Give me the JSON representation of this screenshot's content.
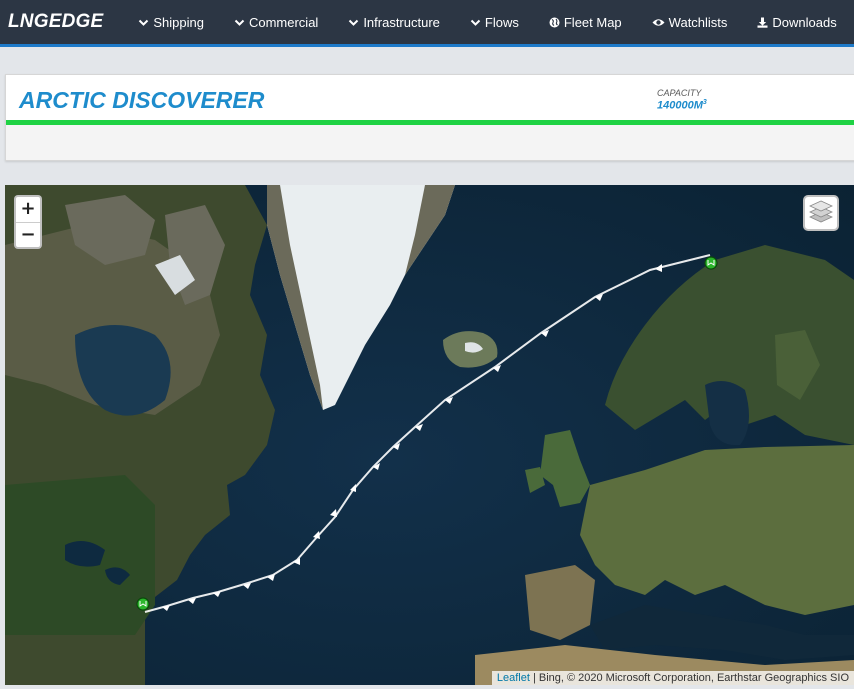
{
  "navbar": {
    "brand": "LNGEDGE",
    "items": [
      {
        "label": "Shipping",
        "icon": "chevron-down-icon"
      },
      {
        "label": "Commercial",
        "icon": "chevron-down-icon"
      },
      {
        "label": "Infrastructure",
        "icon": "chevron-down-icon"
      },
      {
        "label": "Flows",
        "icon": "chevron-down-icon"
      },
      {
        "label": "Fleet Map",
        "icon": "globe-icon"
      },
      {
        "label": "Watchlists",
        "icon": "eye-icon"
      },
      {
        "label": "Downloads",
        "icon": "download-icon"
      }
    ],
    "overflow_icon": "chart-icon",
    "accent_color": "#1e7ac9",
    "background_color": "#2c3644"
  },
  "vessel": {
    "name": "ARCTIC DISCOVERER",
    "capacity_label": "CAPACITY",
    "capacity_value": "140000M",
    "capacity_unit_exp": "3",
    "status_color": "#1fd244"
  },
  "map": {
    "zoom_in": "+",
    "zoom_out": "−",
    "layers_icon": "layers-icon",
    "attribution_link": "Leaflet",
    "attribution_text": " | Bing, © 2020 Microsoft Corporation, Earthstar Geographics SIO",
    "route": {
      "origin_marker": "port-marker-icon",
      "destination_marker": "port-marker-icon",
      "line_color": "#ffffff",
      "marker_color": "#2bb52b"
    }
  }
}
